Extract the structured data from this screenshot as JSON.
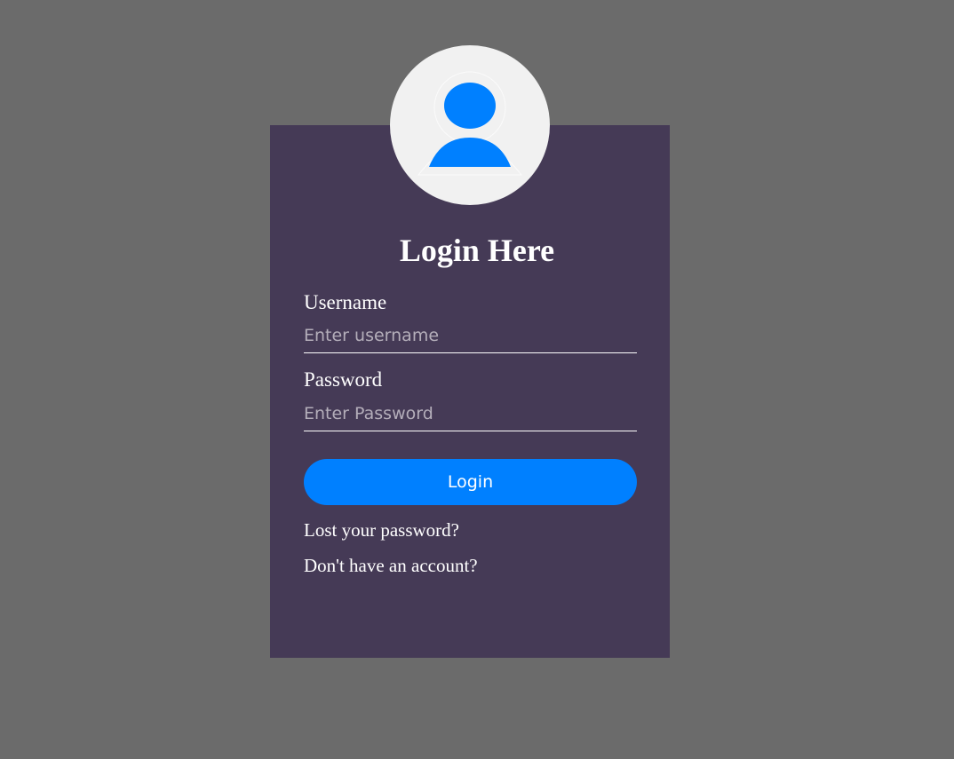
{
  "form": {
    "title": "Login Here",
    "username_label": "Username",
    "username_placeholder": "Enter username",
    "password_label": "Password",
    "password_placeholder": "Enter Password",
    "login_label": "Login",
    "lost_password_link": "Lost your password?",
    "signup_link": "Don't have an account?"
  },
  "avatar": {
    "icon": "user-icon"
  },
  "colors": {
    "page_background": "#6b6b6b",
    "card_background": "#453a56",
    "avatar_background": "#f1f1f1",
    "accent": "#0080ff",
    "text": "#ffffff",
    "placeholder": "#b4aeba"
  }
}
